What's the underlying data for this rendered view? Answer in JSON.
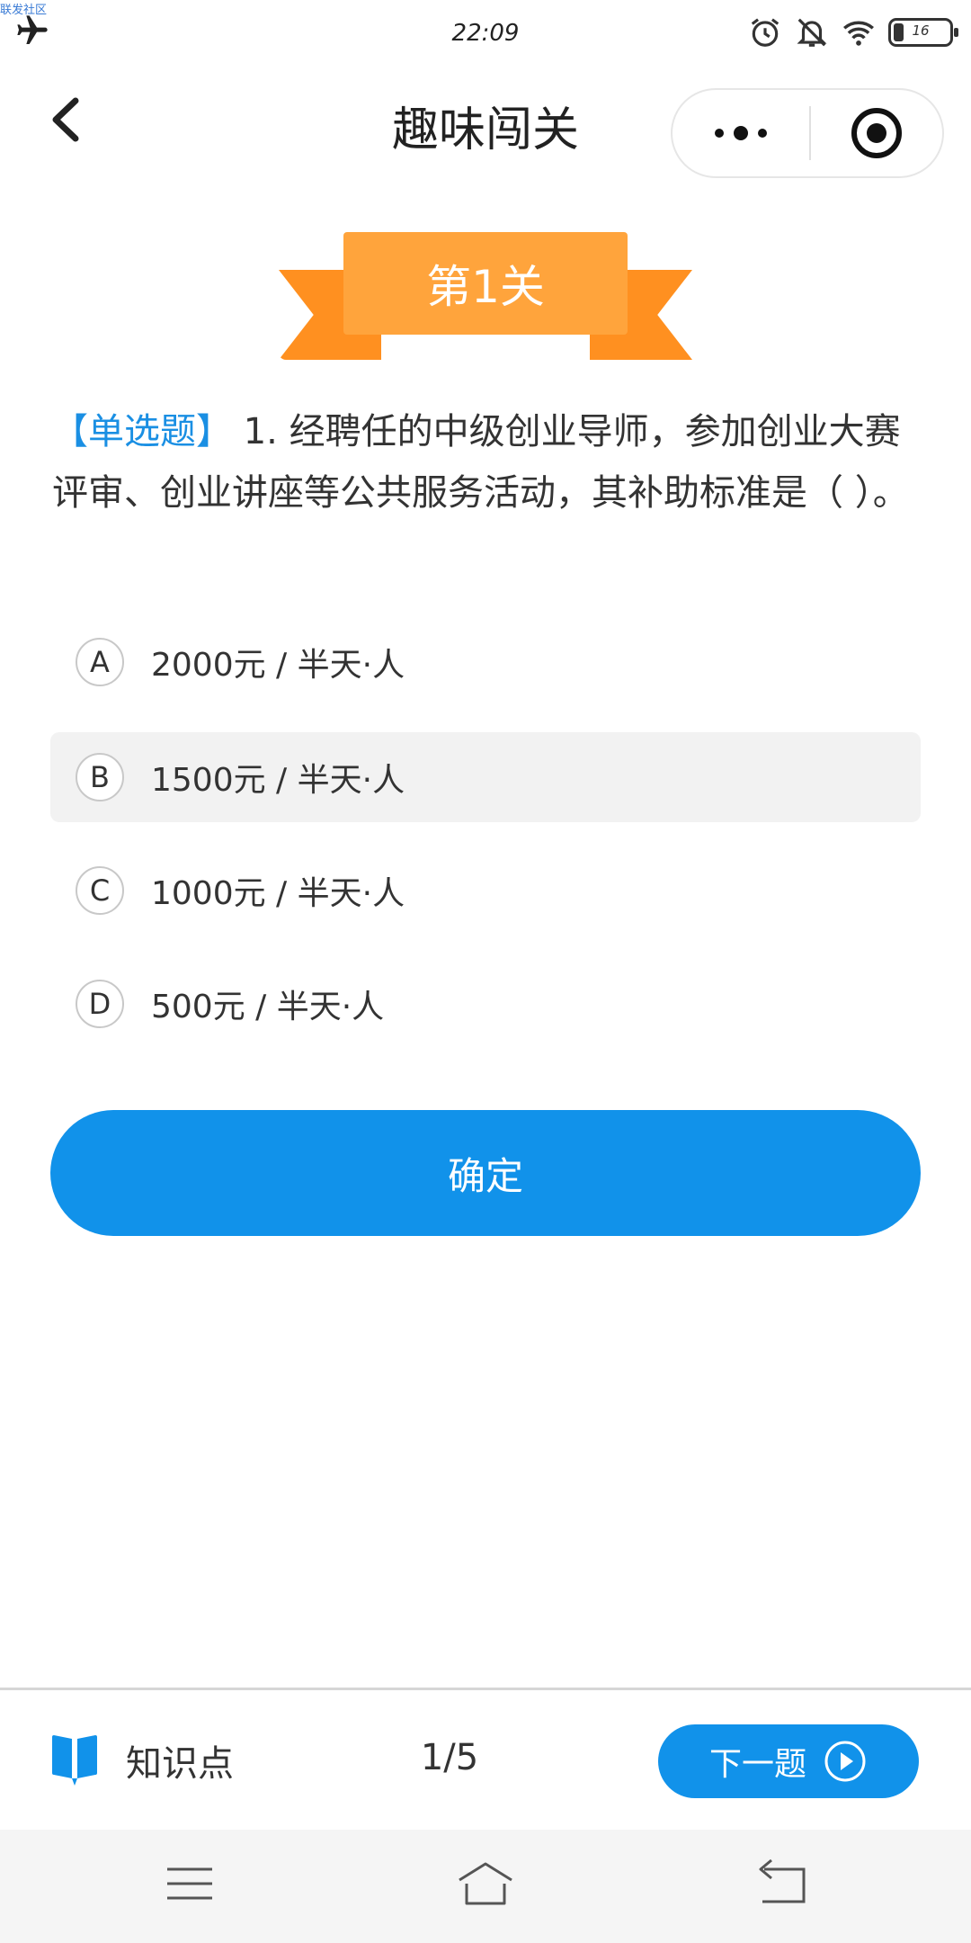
{
  "status_bar": {
    "carrier": "联发社区",
    "time": "22:09",
    "battery": "16"
  },
  "nav": {
    "title": "趣味闯关"
  },
  "level": {
    "label": "第1关"
  },
  "question": {
    "tag": "【单选题】",
    "text": " 1. 经聘任的中级创业导师，参加创业大赛评审、创业讲座等公共服务活动，其补助标准是（ ）。"
  },
  "options": [
    {
      "letter": "A",
      "text": "2000元 / 半天·人",
      "selected": false
    },
    {
      "letter": "B",
      "text": "1500元 / 半天·人",
      "selected": true
    },
    {
      "letter": "C",
      "text": "1000元 / 半天·人",
      "selected": false
    },
    {
      "letter": "D",
      "text": "500元 / 半天·人",
      "selected": false
    }
  ],
  "confirm_label": "确定",
  "bottom": {
    "knowledge_label": "知识点",
    "progress": "1/5",
    "next_label": "下一题"
  },
  "colors": {
    "accent": "#1192ea",
    "ribbon": "#ffa43c",
    "ribbon_tail": "#ff9020"
  },
  "icons": [
    "airplane-icon",
    "alarm-icon",
    "mute-bell-icon",
    "wifi-icon",
    "battery-icon",
    "back-arrow-icon",
    "more-dots-icon",
    "target-icon",
    "book-icon",
    "play-circle-icon",
    "menu-icon",
    "home-icon",
    "return-icon"
  ]
}
